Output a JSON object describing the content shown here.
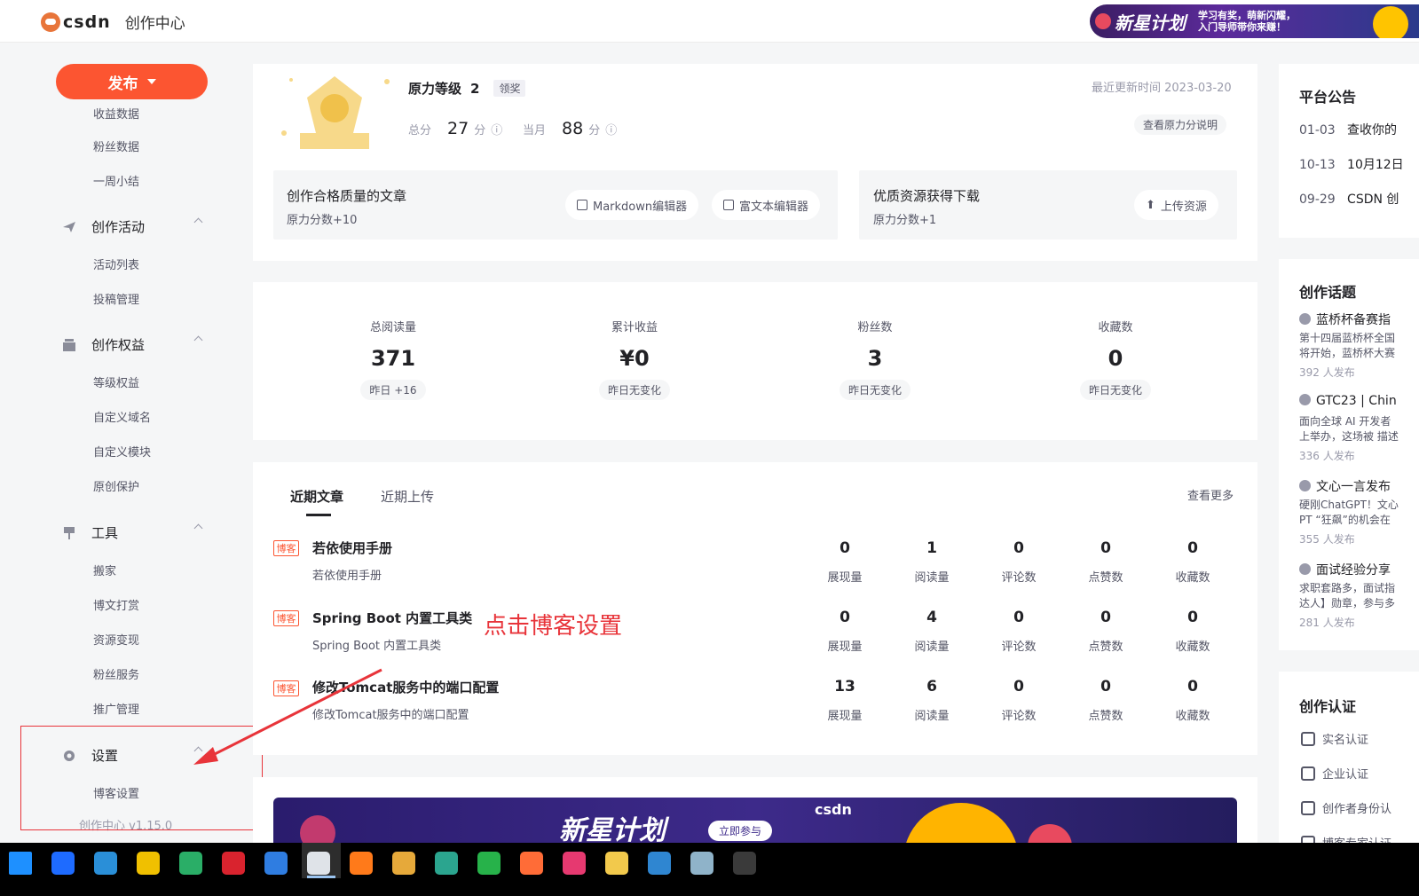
{
  "topbar": {
    "logo": "csdn",
    "subtitle": "创作中心",
    "banner_title": "新星计划",
    "banner_line1": "学习有奖，萌新闪耀，",
    "banner_line2": "入门导师带你来赚！"
  },
  "sidebar": {
    "publish": "发布",
    "cut_item": "收益数据",
    "items_top": [
      "粉丝数据",
      "一周小结"
    ],
    "groups": [
      {
        "label": "创作活动",
        "icon": "paper-plane-icon",
        "items": [
          "活动列表",
          "投稿管理"
        ]
      },
      {
        "label": "创作权益",
        "icon": "gift-icon",
        "items": [
          "等级权益",
          "自定义域名",
          "自定义模块",
          "原创保护"
        ]
      },
      {
        "label": "工具",
        "icon": "tools-icon",
        "items": [
          "搬家",
          "博文打赏",
          "资源变现",
          "粉丝服务",
          "推广管理"
        ]
      },
      {
        "label": "设置",
        "icon": "gear-icon",
        "items": [
          "博客设置"
        ]
      }
    ],
    "version": "创作中心 v1.15.0"
  },
  "level": {
    "title": "原力等级",
    "level": "2",
    "badge": "领奖",
    "total_label": "总分",
    "total_value": "27",
    "total_unit": "分",
    "month_label": "当月",
    "month_value": "88",
    "month_unit": "分",
    "updated": "最近更新时间 2023-03-20",
    "explain_btn": "查看原力分说明",
    "card1_title": "创作合格质量的文章",
    "card1_sub": "原力分数+10",
    "md_btn": "Markdown编辑器",
    "rich_btn": "富文本编辑器",
    "card2_title": "优质资源获得下载",
    "card2_sub": "原力分数+1",
    "upload_btn": "上传资源"
  },
  "stats": [
    {
      "label": "总阅读量",
      "value": "371",
      "change": "昨日 +16"
    },
    {
      "label": "累计收益",
      "value": "¥0",
      "change": "昨日无变化"
    },
    {
      "label": "粉丝数",
      "value": "3",
      "change": "昨日无变化"
    },
    {
      "label": "收藏数",
      "value": "0",
      "change": "昨日无变化"
    }
  ],
  "articles": {
    "tabs": [
      "近期文章",
      "近期上传"
    ],
    "more": "查看更多",
    "tag": "博客",
    "metric_labels": [
      "展现量",
      "阅读量",
      "评论数",
      "点赞数",
      "收藏数"
    ],
    "rows": [
      {
        "title": "若依使用手册",
        "sub": "若依使用手册",
        "metrics": [
          "0",
          "1",
          "0",
          "0",
          "0"
        ]
      },
      {
        "title": "Spring Boot 内置工具类",
        "sub": "Spring Boot 内置工具类",
        "metrics": [
          "0",
          "4",
          "0",
          "0",
          "0"
        ]
      },
      {
        "title": "修改Tomcat服务中的端口配置",
        "sub": "修改Tomcat服务中的端口配置",
        "metrics": [
          "13",
          "6",
          "0",
          "0",
          "0"
        ]
      }
    ]
  },
  "annotation": "点击博客设置",
  "bottom_banner": {
    "title": "新星计划",
    "join": "立即参与",
    "logo": "csdn"
  },
  "right": {
    "notice_title": "平台公告",
    "notices": [
      {
        "date": "01-03",
        "text": "查收你的"
      },
      {
        "date": "10-13",
        "text": "10月12日"
      },
      {
        "date": "09-29",
        "text": "CSDN 创"
      }
    ],
    "topics_title": "创作话题",
    "topics": [
      {
        "title": "蓝桥杯备赛指",
        "desc": "第十四届蓝桥杯全国\n将开始，蓝桥杯大赛",
        "count": "392 人发布"
      },
      {
        "title": "GTC23 | Chin",
        "desc": "面向全球 AI 开发者\n上举办，这场被 描述",
        "count": "336 人发布"
      },
      {
        "title": "文心一言发布",
        "desc": "硬刚ChatGPT！文心\nPT “狂飙”的机会在",
        "count": "355 人发布"
      },
      {
        "title": "面试经验分享",
        "desc": "求职套路多，面试指\n达人】勋章，参与多",
        "count": "281 人发布"
      }
    ],
    "cert_title": "创作认证",
    "certs": [
      "实名认证",
      "企业认证",
      "创作者身份认",
      "博客专家认证"
    ]
  },
  "taskbar": {
    "icons": [
      "windows-start-icon",
      "k-app-icon",
      "edge-icon",
      "qq-icon",
      "wechat-icon",
      "youdao-icon",
      "vscode-icon",
      "chrome-icon",
      "firefox-icon",
      "app-icon",
      "datagrip-icon",
      "hbuilder-icon",
      "postman-icon",
      "intellij-icon",
      "file-explorer-icon",
      "vmware-icon",
      "notepad-icon",
      "terminal-icon"
    ],
    "colors": [
      "#1e90ff",
      "#1e6bff",
      "#2a8fd8",
      "#f0c000",
      "#2aae67",
      "#d9232e",
      "#2f7de1",
      "#dfe3e8",
      "#ff7a1a",
      "#e6a93a",
      "#2ba58f",
      "#27b24a",
      "#ff6c37",
      "#e63970",
      "#f2c94c",
      "#2f86d1",
      "#8fb3c9",
      "#3a3a3a"
    ]
  }
}
